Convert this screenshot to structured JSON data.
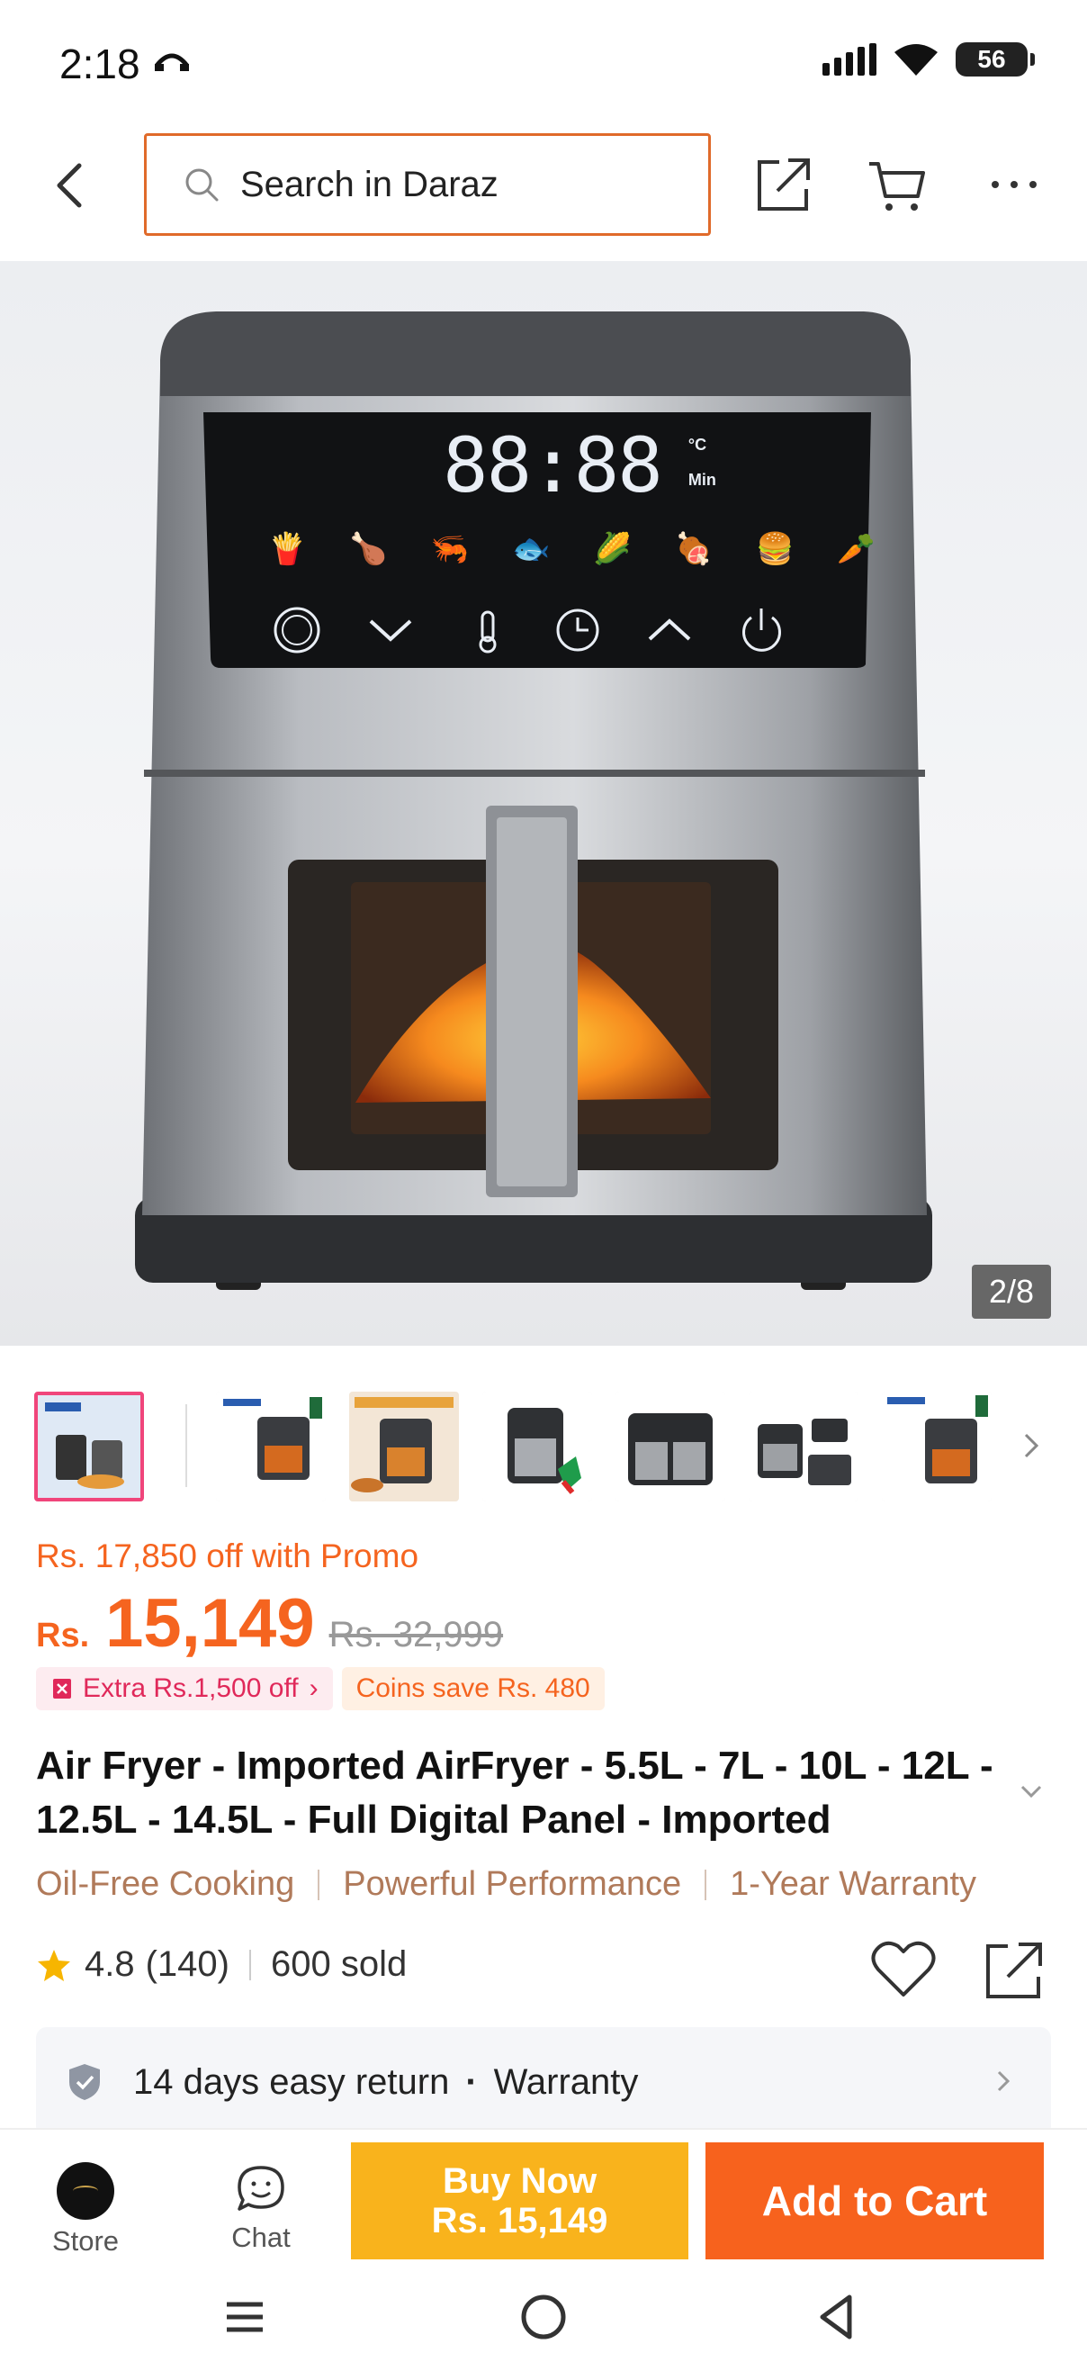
{
  "status_bar": {
    "time": "2:18",
    "notification_glyph": "⌒",
    "battery_level": "56"
  },
  "header": {
    "search_placeholder": "Search in Daraz"
  },
  "gallery": {
    "counter": "2/8",
    "display_digits": "88:88",
    "display_unit_temp": "°C",
    "display_unit_min": "Min"
  },
  "product": {
    "promo_text": "Rs. 17,850 off with Promo",
    "currency": "Rs.",
    "price": "15,149",
    "original_price": "Rs. 32,999",
    "extra_discount": "Extra Rs.1,500 off",
    "coins_save": "Coins save Rs. 480",
    "title": "Air Fryer - Imported AirFryer - 5.5L - 7L - 10L - 12L - 12.5L - 14.5L - Full Digital Panel - Imported",
    "features": [
      "Oil-Free Cooking",
      "Powerful Performance",
      "1-Year Warranty"
    ],
    "rating": "4.8",
    "rating_count": "(140)",
    "sold": "600 sold"
  },
  "service": {
    "return_text": "14 days easy return",
    "warranty_text": "Warranty"
  },
  "bottom_bar": {
    "store_label": "Store",
    "chat_label": "Chat",
    "buy_now_label": "Buy Now",
    "buy_now_price": "Rs. 15,149",
    "add_to_cart_label": "Add to Cart"
  },
  "colors": {
    "brand_orange": "#f7621d",
    "buy_now_yellow": "#f9b31c",
    "search_border": "#e06a2a",
    "feature_brown": "#b07a5a"
  }
}
